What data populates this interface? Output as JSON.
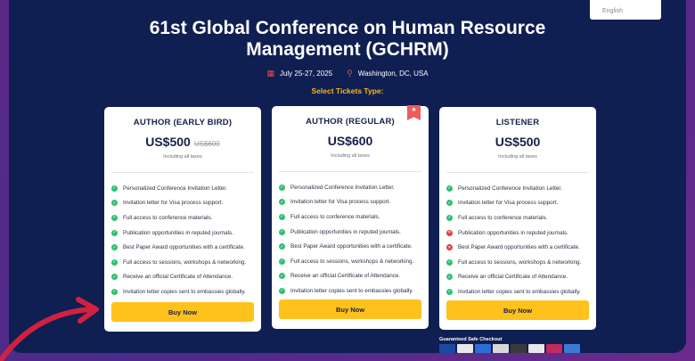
{
  "header": {
    "title_line1": "61st Global Conference on Human Resource",
    "title_line2": "Management (GCHRM)",
    "date": "July 25-27, 2025",
    "location": "Washington, DC, USA",
    "select_label": "Select Tickets Type:"
  },
  "language_chip": {
    "label": "English"
  },
  "tickets": [
    {
      "name": "AUTHOR (EARLY BIRD)",
      "price": "US$500",
      "old_price": "US$600",
      "tax_note": "Including all taxes",
      "features": [
        {
          "text": "Personalized Conference Invitation Letter.",
          "included": true
        },
        {
          "text": "Invitation letter for Visa process support.",
          "included": true
        },
        {
          "text": "Full access to conference materials.",
          "included": true
        },
        {
          "text": "Publication opportunities in reputed journals.",
          "included": true
        },
        {
          "text": "Best Paper Award opportunities with a certificate.",
          "included": true
        },
        {
          "text": "Full access to sessions, workshops & networking.",
          "included": true
        },
        {
          "text": "Receive an official Certificate of Attendance.",
          "included": true
        },
        {
          "text": "Invitation letter copies sent to embassies globally.",
          "included": true
        }
      ],
      "button": "Buy Now"
    },
    {
      "name": "AUTHOR (REGULAR)",
      "price": "US$600",
      "tax_note": "Including all taxes",
      "features": [
        {
          "text": "Personalized Conference Invitation Letter.",
          "included": true
        },
        {
          "text": "Invitation letter for Visa process support.",
          "included": true
        },
        {
          "text": "Full access to conference materials.",
          "included": true
        },
        {
          "text": "Publication opportunities in reputed journals.",
          "included": true
        },
        {
          "text": "Best Paper Award opportunities with a certificate.",
          "included": true
        },
        {
          "text": "Full access to sessions, workshops & networking.",
          "included": true
        },
        {
          "text": "Receive an official Certificate of Attendance.",
          "included": true
        },
        {
          "text": "Invitation letter copies sent to embassies globally.",
          "included": true
        }
      ],
      "button": "Buy Now"
    },
    {
      "name": "LISTENER",
      "price": "US$500",
      "tax_note": "Including all taxes",
      "features": [
        {
          "text": "Personalized Conference Invitation Letter.",
          "included": true
        },
        {
          "text": "Invitation letter for Visa process support.",
          "included": true
        },
        {
          "text": "Full access to conference materials.",
          "included": true
        },
        {
          "text": "Publication opportunities in reputed journals.",
          "included": false
        },
        {
          "text": "Best Paper Award opportunities with a certificate.",
          "included": false
        },
        {
          "text": "Full access to sessions, workshops & networking.",
          "included": true
        },
        {
          "text": "Receive an official Certificate of Attendance.",
          "included": true
        },
        {
          "text": "Invitation letter copies sent to embassies globally.",
          "included": true
        }
      ],
      "button": "Buy Now"
    }
  ],
  "checkout": {
    "label": "Guaranteed Safe Checkout"
  },
  "icons": {
    "date": "calendar-icon",
    "location": "location-pin-icon",
    "included": "check-circle-icon",
    "excluded": "x-circle-icon",
    "ribbon": "star-ribbon-icon"
  },
  "colors": {
    "background": "#0f1f52",
    "accent": "#ffc21c",
    "included": "#2fbf71",
    "excluded": "#e23b3b",
    "ribbon": "#ef5a5a",
    "arrow": "#d0213f"
  }
}
